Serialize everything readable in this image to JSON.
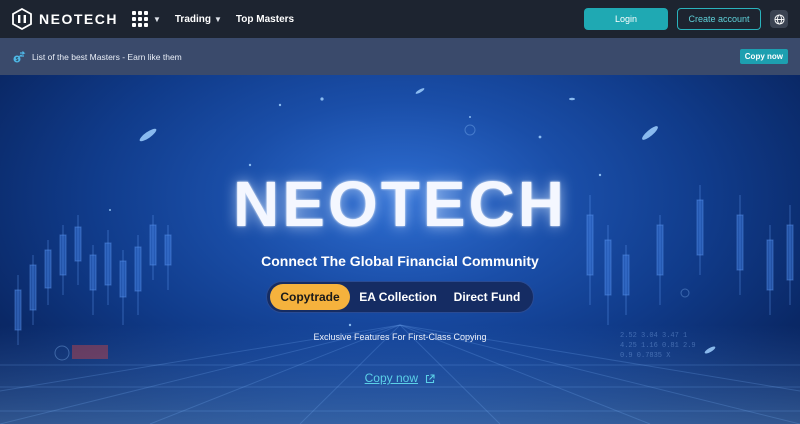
{
  "header": {
    "brand": "NEOTECH",
    "nav": {
      "trading_label": "Trading",
      "top_masters_label": "Top Masters"
    },
    "login_label": "Login",
    "create_account_label": "Create account"
  },
  "announcement": {
    "text": "List of the best Masters - Earn like them",
    "cta_label": "Copy now"
  },
  "hero": {
    "title": "NEOTECH",
    "subtitle": "Connect The Global Financial Community",
    "tabs": [
      {
        "label": "Copytrade",
        "active": true
      },
      {
        "label": "EA Collection",
        "active": false
      },
      {
        "label": "Direct Fund",
        "active": false
      }
    ],
    "tagline": "Exclusive Features For First-Class Copying",
    "cta_label": "Copy now"
  },
  "icons": {
    "logo": "neotech-logo-icon",
    "apps": "apps-grid-icon",
    "globe": "globe-icon",
    "announcement": "money-transfer-icon",
    "external": "external-link-icon"
  },
  "colors": {
    "topbar_bg": "#1d2430",
    "announce_bg": "#3a4a6b",
    "login_bg": "#1fa9b3",
    "accent_teal": "#2ab3bd",
    "active_tab": "#f5b23d",
    "link": "#5bd0e8"
  }
}
